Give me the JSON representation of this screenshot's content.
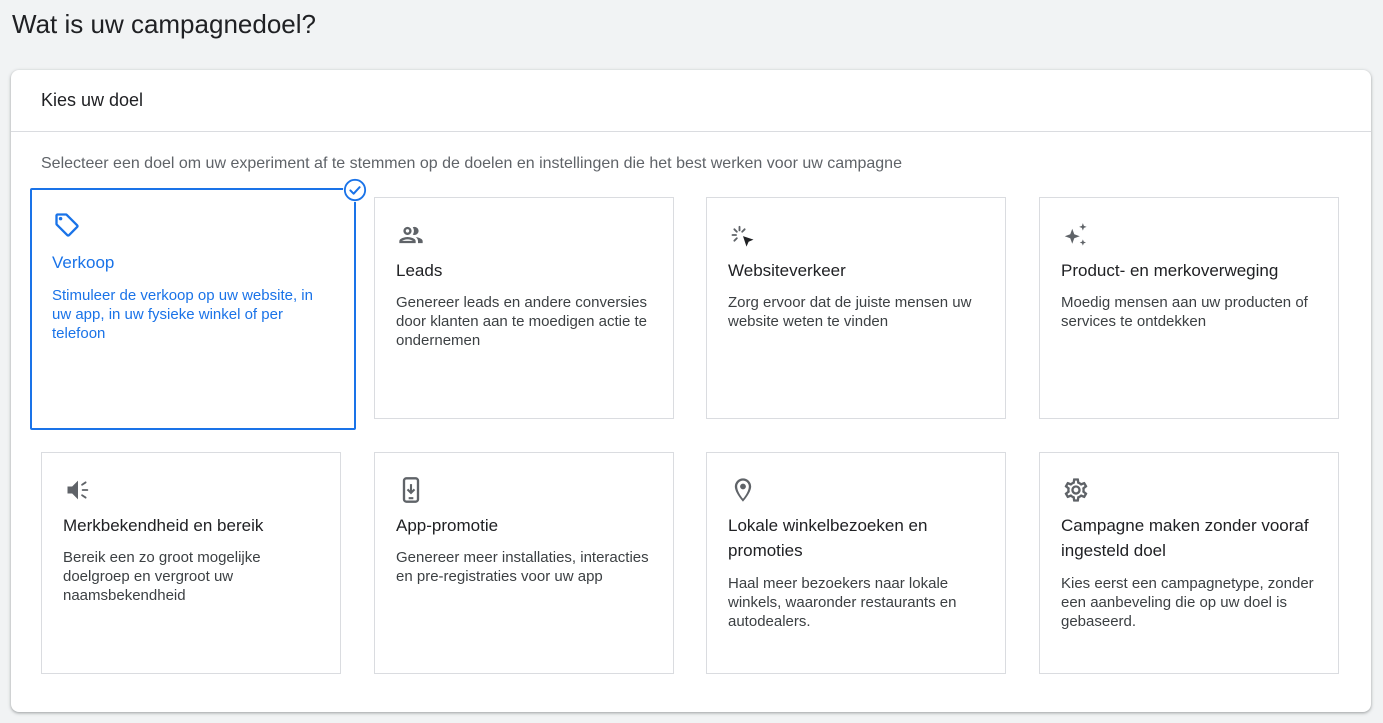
{
  "page": {
    "title": "Wat is uw campagnedoel?"
  },
  "panel": {
    "header": "Kies uw doel",
    "instruction": "Selecteer een doel om uw experiment af te stemmen op de doelen en instellingen die het best werken voor uw campagne"
  },
  "colors": {
    "accent": "#1a73e8",
    "icon": "#5f6368",
    "border": "#dadce0"
  },
  "goals": [
    {
      "icon": "tag-icon",
      "title": "Verkoop",
      "description": "Stimuleer de verkoop op uw website, in uw app, in uw fysieke winkel of per telefoon",
      "selected": true
    },
    {
      "icon": "people-icon",
      "title": "Leads",
      "description": "Genereer leads en andere conversies door klanten aan te moedigen actie te ondernemen",
      "selected": false
    },
    {
      "icon": "cursor-click-icon",
      "title": "Websiteverkeer",
      "description": "Zorg ervoor dat de juiste mensen uw website weten te vinden",
      "selected": false
    },
    {
      "icon": "sparkle-icon",
      "title": "Product- en merkoverweging",
      "description": "Moedig mensen aan uw producten of services te ontdekken",
      "selected": false
    },
    {
      "icon": "megaphone-icon",
      "title": "Merkbekendheid en bereik",
      "description": "Bereik een zo groot mogelijke doelgroep en vergroot uw naamsbekendheid",
      "selected": false
    },
    {
      "icon": "phone-download-icon",
      "title": "App-promotie",
      "description": "Genereer meer installaties, interacties en pre-registraties voor uw app",
      "selected": false
    },
    {
      "icon": "location-pin-icon",
      "title": "Lokale winkelbezoeken en promoties",
      "description": "Haal meer bezoekers naar lokale winkels, waaronder restaurants en autodealers.",
      "selected": false
    },
    {
      "icon": "gear-icon",
      "title": "Campagne maken zonder vooraf ingesteld doel",
      "description": "Kies eerst een campagnetype, zonder een aanbeveling die op uw doel is gebaseerd.",
      "selected": false
    }
  ]
}
